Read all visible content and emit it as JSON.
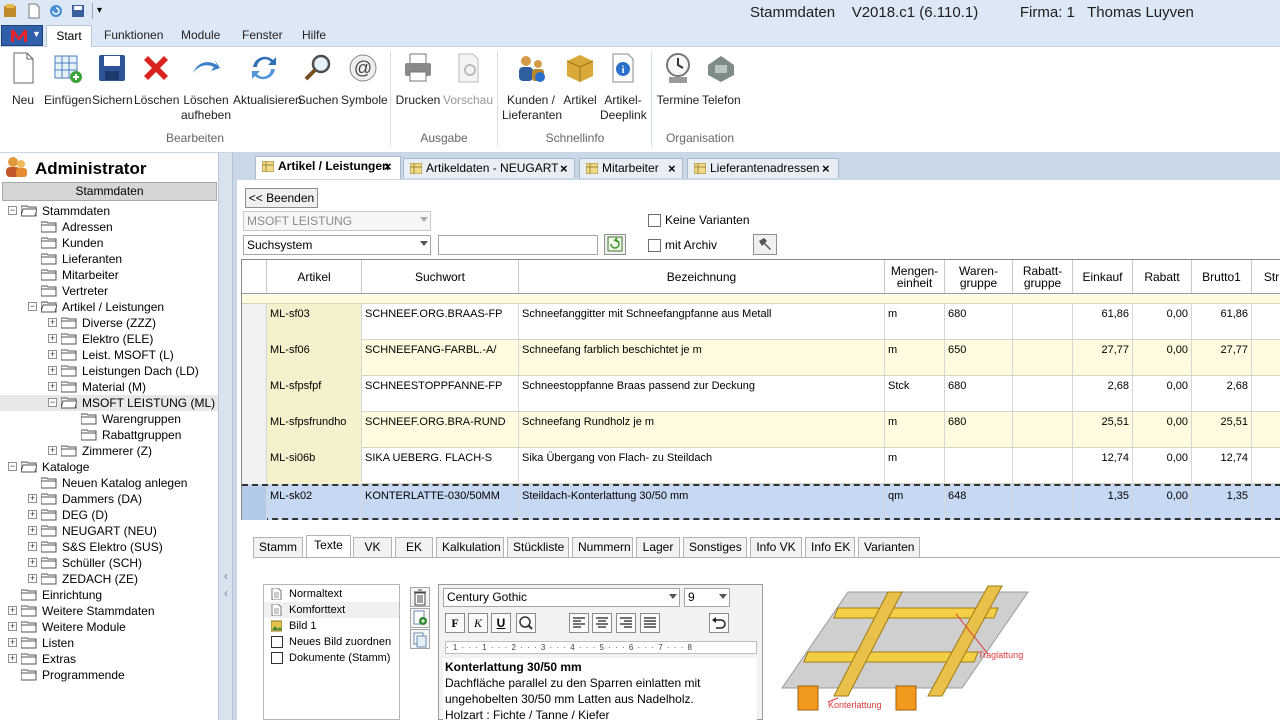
{
  "window": {
    "title": "Stammdaten    V2018.c1 (6.110.1)          Firma: 1   Thomas Luyven"
  },
  "menu": {
    "items": [
      "Start",
      "Funktionen",
      "Module",
      "Fenster",
      "Hilfe"
    ]
  },
  "ribbon": {
    "bearbeiten": [
      "Neu",
      "Einfügen",
      "Sichern",
      "Löschen",
      "Löschen aufheben",
      "Aktualisieren",
      "Suchen",
      "Symbole"
    ],
    "ausgabe": [
      "Drucken",
      "Vorschau"
    ],
    "schnellinfo": [
      "Kunden / Lieferanten",
      "Artikel",
      "Artikel-Deeplink"
    ],
    "organisation": [
      "Termine",
      "Telefon"
    ],
    "groups": [
      "Bearbeiten",
      "Ausgabe",
      "Schnellinfo",
      "Organisation"
    ]
  },
  "sidebar": {
    "user": "Administrator",
    "section": "Stammdaten",
    "tree": [
      {
        "label": "Stammdaten",
        "level": 0,
        "exp": "-"
      },
      {
        "label": "Adressen",
        "level": 1,
        "exp": ""
      },
      {
        "label": "Kunden",
        "level": 1,
        "exp": ""
      },
      {
        "label": "Lieferanten",
        "level": 1,
        "exp": ""
      },
      {
        "label": "Mitarbeiter",
        "level": 1,
        "exp": ""
      },
      {
        "label": "Vertreter",
        "level": 1,
        "exp": ""
      },
      {
        "label": "Artikel / Leistungen",
        "level": 1,
        "exp": "-"
      },
      {
        "label": "Diverse (ZZZ)",
        "level": 2,
        "exp": "+"
      },
      {
        "label": "Elektro (ELE)",
        "level": 2,
        "exp": "+"
      },
      {
        "label": "Leist. MSOFT (L)",
        "level": 2,
        "exp": "+"
      },
      {
        "label": "Leistungen Dach (LD)",
        "level": 2,
        "exp": "+"
      },
      {
        "label": "Material (M)",
        "level": 2,
        "exp": "+"
      },
      {
        "label": "MSOFT LEISTUNG (ML)",
        "level": 2,
        "exp": "-"
      },
      {
        "label": "Warengruppen",
        "level": 3,
        "exp": ""
      },
      {
        "label": "Rabattgruppen",
        "level": 3,
        "exp": ""
      },
      {
        "label": "Zimmerer (Z)",
        "level": 2,
        "exp": "+"
      },
      {
        "label": "Kataloge",
        "level": 0,
        "exp": "-"
      },
      {
        "label": "Neuen Katalog anlegen",
        "level": 1,
        "exp": ""
      },
      {
        "label": "Dammers (DA)",
        "level": 1,
        "exp": "+"
      },
      {
        "label": "DEG (D)",
        "level": 1,
        "exp": "+"
      },
      {
        "label": "NEUGART (NEU)",
        "level": 1,
        "exp": "+"
      },
      {
        "label": "S&S Elektro (SUS)",
        "level": 1,
        "exp": "+"
      },
      {
        "label": "Schüller (SCH)",
        "level": 1,
        "exp": "+"
      },
      {
        "label": "ZEDACH (ZE)",
        "level": 1,
        "exp": "+"
      },
      {
        "label": "Einrichtung",
        "level": 0,
        "exp": ""
      },
      {
        "label": "Weitere Stammdaten",
        "level": 0,
        "exp": "+"
      },
      {
        "label": "Weitere Module",
        "level": 0,
        "exp": "+"
      },
      {
        "label": "Listen",
        "level": 0,
        "exp": "+"
      },
      {
        "label": "Extras",
        "level": 0,
        "exp": "+"
      },
      {
        "label": "Programmende",
        "level": 0,
        "exp": ""
      }
    ]
  },
  "doc_tabs": [
    "Artikel / Leistungen",
    "Artikeldaten - NEUGART",
    "Mitarbeiter",
    "Lieferantenadressen"
  ],
  "toolbar": {
    "back_label": "<< Beenden",
    "catalog_value": "MSOFT LEISTUNG",
    "search_mode": "Suchsystem",
    "search_value": "",
    "no_variants": "Keine Varianten",
    "with_archive": "mit Archiv"
  },
  "grid": {
    "columns": [
      "Artikel",
      "Suchwort",
      "Bezeichnung",
      "Mengen-einheit",
      "Waren-gruppe",
      "Rabatt-gruppe",
      "Einkauf",
      "Rabatt",
      "Brutto1",
      "Str"
    ],
    "rows": [
      [
        "ML-sf03",
        "SCHNEEF.ORG.BRAAS-FP",
        "Schneefanggitter mit Schneefangpfanne aus Metall",
        "m",
        "680",
        "",
        "61,86",
        "0,00",
        "61,86"
      ],
      [
        "ML-sf06",
        "SCHNEEFANG-FARBL.-A/",
        "Schneefang farblich beschichtet je m",
        "m",
        "650",
        "",
        "27,77",
        "0,00",
        "27,77"
      ],
      [
        "ML-sfpsfpf",
        "SCHNEESTOPPFANNE-FP",
        "Schneestoppfanne Braas passend zur Deckung",
        "Stck",
        "680",
        "",
        "2,68",
        "0,00",
        "2,68"
      ],
      [
        "ML-sfpsfrundho",
        "SCHNEEF.ORG.BRA-RUND",
        "Schneefang Rundholz je m",
        "m",
        "680",
        "",
        "25,51",
        "0,00",
        "25,51"
      ],
      [
        "ML-si06b",
        "SIKA UEBERG. FLACH-S",
        "Sika Übergang von Flach- zu Steildach",
        "m",
        "",
        "",
        "12,74",
        "0,00",
        "12,74"
      ],
      [
        "ML-sk02",
        "KONTERLATTE-030/50MM",
        "Steildach-Konterlattung 30/50 mm",
        "qm",
        "648",
        "",
        "1,35",
        "0,00",
        "1,35"
      ]
    ]
  },
  "bottom_tabs": [
    "Stamm",
    "Texte",
    "VK",
    "EK",
    "Kalkulation",
    "Stückliste",
    "Nummern",
    "Lager",
    "Sonstiges",
    "Info VK",
    "Info EK",
    "Varianten"
  ],
  "text_list": [
    "Normaltext",
    "Komforttext",
    "Bild 1",
    "Neues Bild zuordnen",
    "Dokumente (Stamm)"
  ],
  "editor": {
    "font": "Century Gothic",
    "size": "9",
    "ruler": "· 1 · · · 1 · · · 2 · · · 3 · · · 4 · · · 5 · · · 6 · · · 7 · · · 8",
    "heading": "Konterlattung 30/50 mm",
    "lines": [
      "Dachfläche parallel zu den Sparren einlatten mit",
      "ungehobelten 30/50 mm Latten aus Nadelholz.",
      "Holzart : Fichte / Tanne / Kiefer"
    ]
  },
  "image_labels": {
    "trag": "Traglattung",
    "konter": "Konterlattung"
  },
  "colors": {
    "accent": "#2f5fa8",
    "row_alt": "#fffbe1",
    "row_sel": "#c7d8f2",
    "first_col": "#f5f1cc"
  }
}
